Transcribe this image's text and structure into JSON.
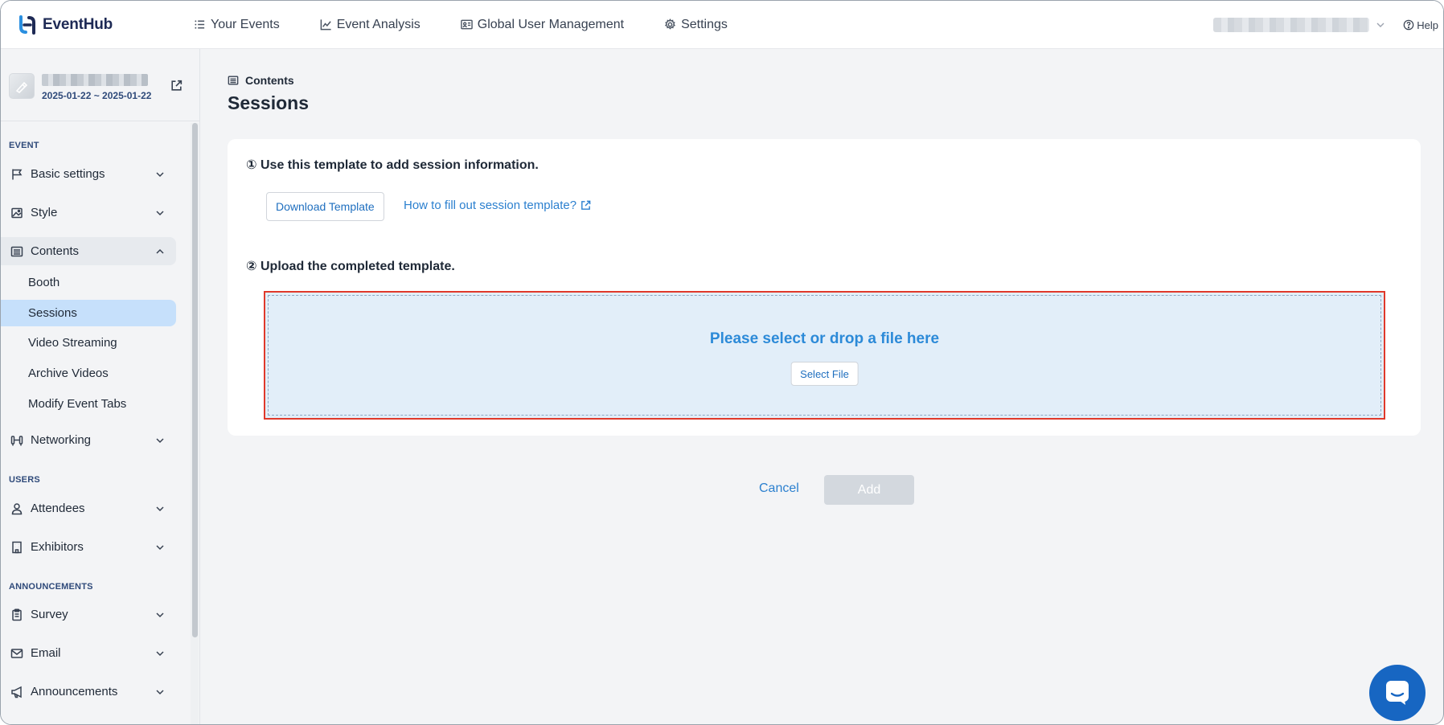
{
  "app": {
    "logo_text": "EventHub"
  },
  "topnav": {
    "items": [
      {
        "label": "Your Events",
        "icon": "list-icon"
      },
      {
        "label": "Event Analysis",
        "icon": "chart-line-icon"
      },
      {
        "label": "Global User Management",
        "icon": "id-card-icon"
      },
      {
        "label": "Settings",
        "icon": "gear-icon"
      }
    ],
    "help_label": "Help"
  },
  "event": {
    "date_range": "2025-01-22 ~ 2025-01-22"
  },
  "sidebar": {
    "sections": {
      "event": "EVENT",
      "users": "USERS",
      "announcements": "ANNOUNCEMENTS"
    },
    "items": {
      "basic_settings": "Basic settings",
      "style": "Style",
      "contents": "Contents",
      "networking": "Networking",
      "attendees": "Attendees",
      "exhibitors": "Exhibitors",
      "survey": "Survey",
      "email": "Email",
      "announcements": "Announcements"
    },
    "contents_sub": [
      "Booth",
      "Sessions",
      "Video Streaming",
      "Archive Videos",
      "Modify Event Tabs"
    ],
    "active_sub": "Sessions"
  },
  "main": {
    "breadcrumb": "Contents",
    "title": "Sessions",
    "step1": "① Use this template to add session information.",
    "download_button": "Download Template",
    "howto_link": "How to fill out session template?",
    "step2": "② Upload the completed template.",
    "dropzone_text": "Please select or drop a file here",
    "select_file_button": "Select File",
    "cancel_label": "Cancel",
    "add_label": "Add"
  },
  "colors": {
    "accent": "#2c80cf",
    "active_sidebar": "#c6e0fb",
    "dropzone_bg": "#e2eef9",
    "highlight_border": "#e0392b",
    "chat_button": "#1766c2"
  }
}
